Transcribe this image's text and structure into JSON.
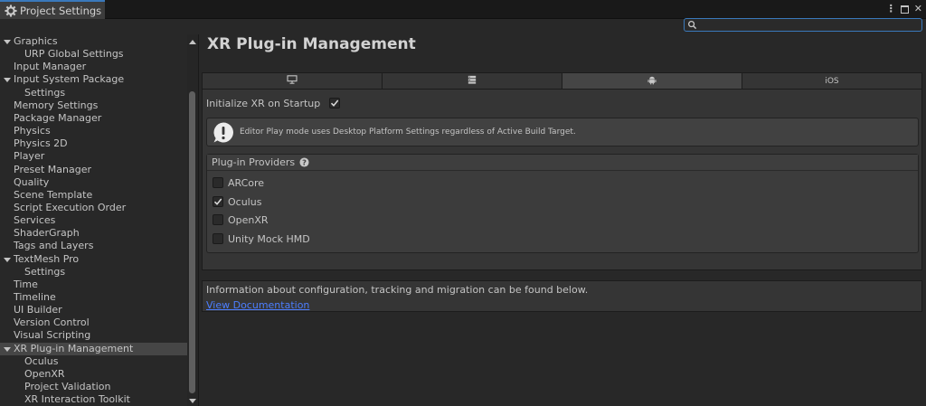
{
  "window": {
    "tab_title": "Project Settings",
    "tab_icon": "gear-icon"
  },
  "search": {
    "value": "",
    "placeholder": ""
  },
  "sidebar": {
    "items": [
      {
        "label": "Graphics",
        "indent": 0,
        "foldout": true
      },
      {
        "label": "URP Global Settings",
        "indent": 1
      },
      {
        "label": "Input Manager",
        "indent": 0
      },
      {
        "label": "Input System Package",
        "indent": 0,
        "foldout": true
      },
      {
        "label": "Settings",
        "indent": 1
      },
      {
        "label": "Memory Settings",
        "indent": 0
      },
      {
        "label": "Package Manager",
        "indent": 0
      },
      {
        "label": "Physics",
        "indent": 0
      },
      {
        "label": "Physics 2D",
        "indent": 0
      },
      {
        "label": "Player",
        "indent": 0
      },
      {
        "label": "Preset Manager",
        "indent": 0
      },
      {
        "label": "Quality",
        "indent": 0
      },
      {
        "label": "Scene Template",
        "indent": 0
      },
      {
        "label": "Script Execution Order",
        "indent": 0
      },
      {
        "label": "Services",
        "indent": 0
      },
      {
        "label": "ShaderGraph",
        "indent": 0
      },
      {
        "label": "Tags and Layers",
        "indent": 0
      },
      {
        "label": "TextMesh Pro",
        "indent": 0,
        "foldout": true
      },
      {
        "label": "Settings",
        "indent": 1
      },
      {
        "label": "Time",
        "indent": 0
      },
      {
        "label": "Timeline",
        "indent": 0
      },
      {
        "label": "UI Builder",
        "indent": 0
      },
      {
        "label": "Version Control",
        "indent": 0
      },
      {
        "label": "Visual Scripting",
        "indent": 0
      },
      {
        "label": "XR Plug-in Management",
        "indent": 0,
        "foldout": true,
        "selected": true
      },
      {
        "label": "Oculus",
        "indent": 1
      },
      {
        "label": "OpenXR",
        "indent": 1
      },
      {
        "label": "Project Validation",
        "indent": 1
      },
      {
        "label": "XR Interaction Toolkit",
        "indent": 1
      }
    ]
  },
  "main": {
    "title": "XR Plug-in Management",
    "platform_tabs": [
      {
        "icon": "desktop-icon",
        "label": "",
        "active": false
      },
      {
        "icon": "server-icon",
        "label": "",
        "active": false
      },
      {
        "icon": "android-icon",
        "label": "",
        "active": true
      },
      {
        "icon": "",
        "label": "iOS",
        "active": false
      }
    ],
    "init_label": "Initialize XR on Startup",
    "init_checked": true,
    "help_message": "Editor Play mode uses Desktop Platform Settings regardless of Active Build Target.",
    "providers_title": "Plug-in Providers",
    "providers": [
      {
        "label": "ARCore",
        "checked": false
      },
      {
        "label": "Oculus",
        "checked": true
      },
      {
        "label": "OpenXR",
        "checked": false
      },
      {
        "label": "Unity Mock HMD",
        "checked": false
      }
    ],
    "info_text": "Information about configuration, tracking and migration can be found below.",
    "doc_link": "View Documentation"
  },
  "colors": {
    "accent": "#3a79bb",
    "link": "#4c7eff",
    "selected_row": "#464646"
  }
}
